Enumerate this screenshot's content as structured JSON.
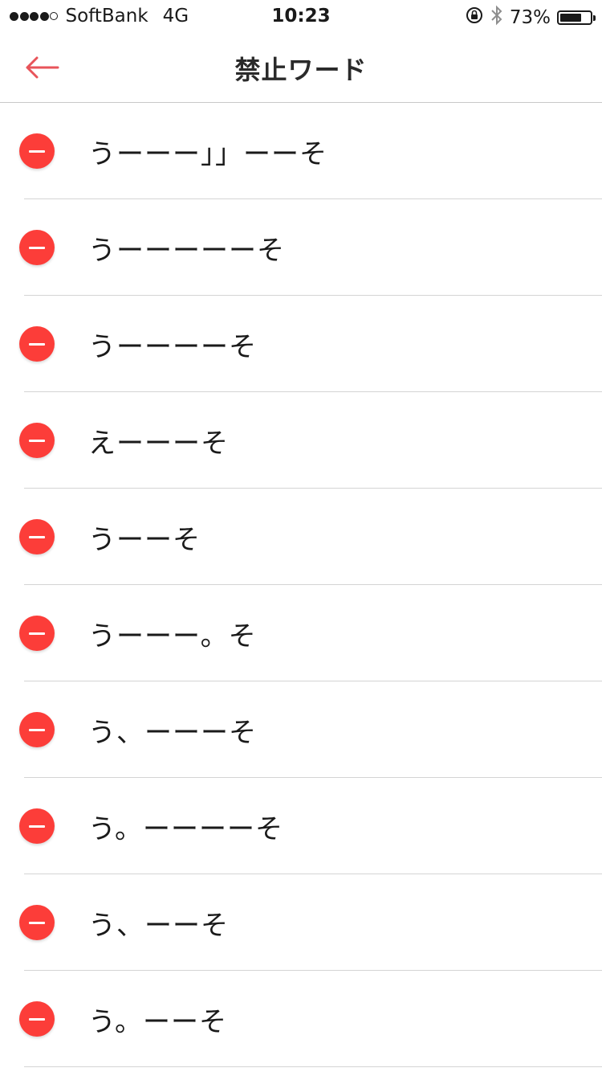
{
  "status_bar": {
    "carrier": "SoftBank",
    "network": "4G",
    "time": "10:23",
    "battery": "73%",
    "battery_level": 0.73
  },
  "nav": {
    "title": "禁止ワード",
    "back_icon": "back-arrow-icon",
    "accent_color": "#e8545a"
  },
  "delete_color": "#fc3d39",
  "words": [
    "うーーー」」ーーそ",
    "うーーーーーそ",
    "うーーーーそ",
    "えーーーそ",
    "うーーそ",
    "うーーー。そ",
    "う、ーーーそ",
    "う。ーーーーそ",
    "う、ーーそ",
    "う。ーーそ"
  ]
}
